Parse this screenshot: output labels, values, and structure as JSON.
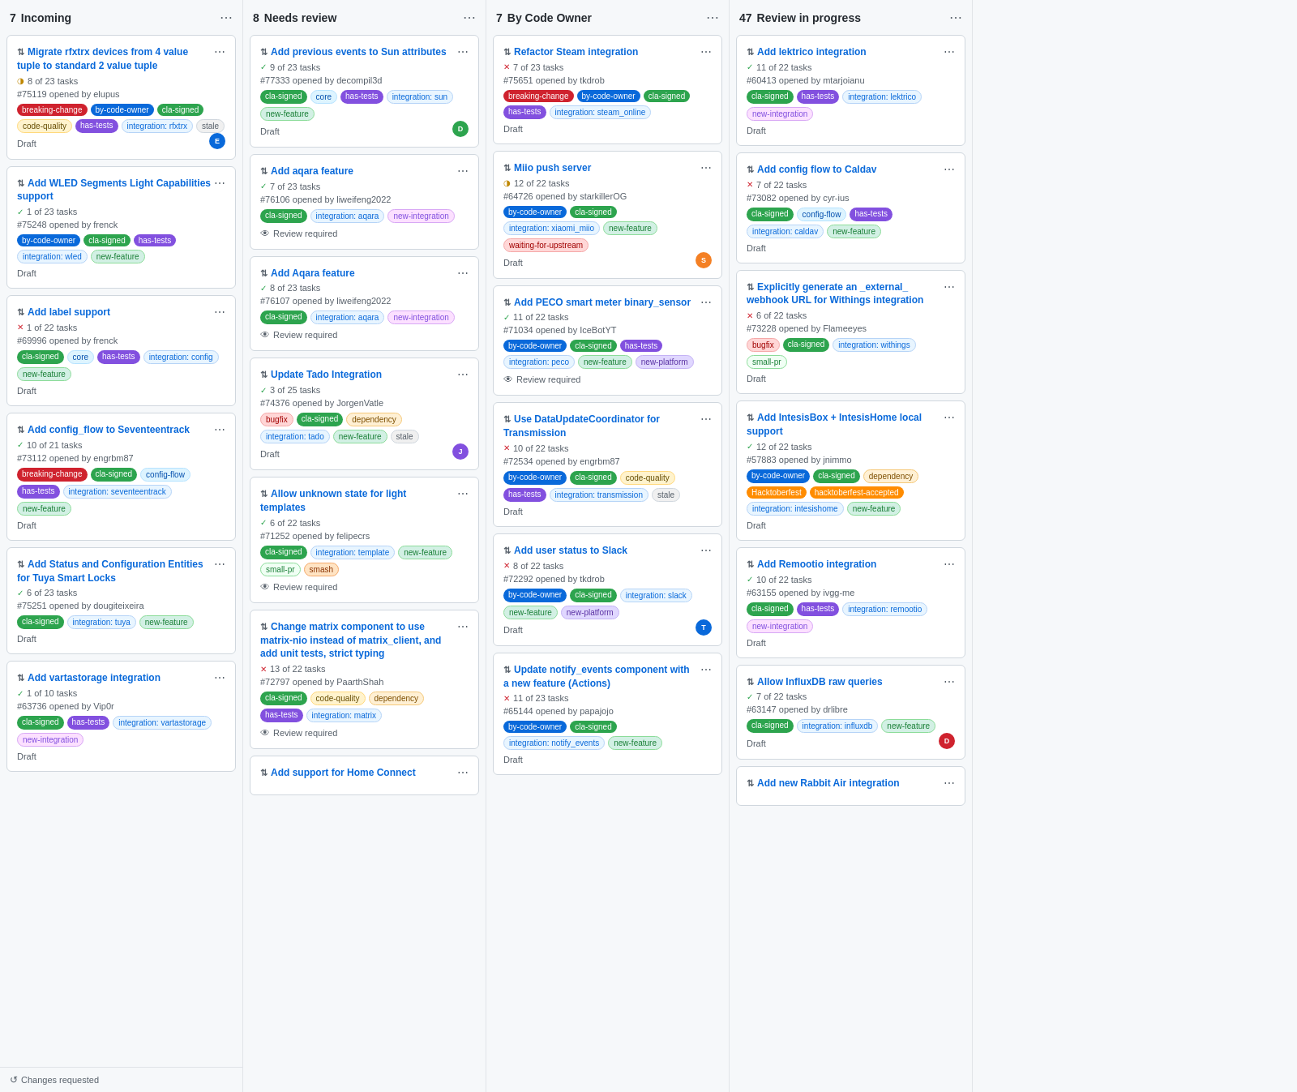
{
  "columns": [
    {
      "id": "incoming",
      "count": "7",
      "title": "Incoming",
      "footer": "Changes requested",
      "cards": [
        {
          "id": "card-1",
          "title": "Migrate rfxtrx devices from 4 value tuple to standard 2 value tuple",
          "tasks": "8 of 23 tasks",
          "task_status": "partial",
          "issue": "#75119 opened by elupus",
          "tags": [
            "breaking-change",
            "by-code-owner",
            "cla-signed",
            "code-quality",
            "has-tests",
            "integration: rfxtrx",
            "stale"
          ],
          "tag_types": {
            "breaking-change": "breaking",
            "by-code-owner": "by-code-owner",
            "cla-signed": "cla-signed",
            "code-quality": "code-quality",
            "has-tests": "has-tests",
            "integration: rfxtrx": "integration",
            "stale": "stale"
          },
          "status": "Draft",
          "avatar": "E",
          "avatar_color": "blue"
        },
        {
          "id": "card-2",
          "title": "Add WLED Segments Light Capabilities support",
          "tasks": "1 of 23 tasks",
          "task_status": "complete",
          "issue": "#75248 opened by frenck",
          "tags": [
            "by-code-owner",
            "cla-signed",
            "has-tests",
            "integration: wled",
            "new-feature"
          ],
          "tag_types": {
            "by-code-owner": "by-code-owner",
            "cla-signed": "cla-signed",
            "has-tests": "has-tests",
            "integration: wled": "integration",
            "new-feature": "new-feature"
          },
          "status": "Draft",
          "avatar": null
        },
        {
          "id": "card-3",
          "title": "Add label support",
          "tasks": "1 of 22 tasks",
          "task_status": "cross",
          "issue": "#69996 opened by frenck",
          "tags": [
            "cla-signed",
            "core",
            "has-tests",
            "integration: config",
            "new-feature"
          ],
          "tag_types": {
            "cla-signed": "cla-signed",
            "core": "core",
            "has-tests": "has-tests",
            "integration: config": "integration",
            "new-feature": "new-feature"
          },
          "status": "Draft",
          "avatar": null
        },
        {
          "id": "card-4",
          "title": "Add config_flow to Seventeentrack",
          "tasks": "10 of 21 tasks",
          "task_status": "complete",
          "issue": "#73112 opened by engrbm87",
          "tags": [
            "breaking-change",
            "cla-signed",
            "config-flow",
            "has-tests",
            "integration: seventeentrack",
            "new-feature"
          ],
          "tag_types": {
            "breaking-change": "breaking",
            "cla-signed": "cla-signed",
            "config-flow": "config-flow",
            "has-tests": "has-tests",
            "integration: seventeentrack": "integration",
            "new-feature": "new-feature"
          },
          "status": "Draft",
          "avatar": null
        },
        {
          "id": "card-5",
          "title": "Add Status and Configuration Entities for Tuya Smart Locks",
          "tasks": "6 of 23 tasks",
          "task_status": "complete",
          "issue": "#75251 opened by dougiteixeira",
          "tags": [
            "cla-signed",
            "integration: tuya",
            "new-feature"
          ],
          "tag_types": {
            "cla-signed": "cla-signed",
            "integration: tuya": "integration",
            "new-feature": "new-feature"
          },
          "status": "Draft",
          "avatar": null
        },
        {
          "id": "card-6",
          "title": "Add vartastorage integration",
          "tasks": "1 of 10 tasks",
          "task_status": "complete",
          "issue": "#63736 opened by Vip0r",
          "tags": [
            "cla-signed",
            "has-tests",
            "integration: vartastorage",
            "new-integration"
          ],
          "tag_types": {
            "cla-signed": "cla-signed",
            "has-tests": "has-tests",
            "integration: vartastorage": "integration",
            "new-integration": "new-integration"
          },
          "status": "Draft",
          "avatar": null
        }
      ]
    },
    {
      "id": "needs-review",
      "count": "8",
      "title": "Needs review",
      "footer": null,
      "cards": [
        {
          "id": "nr-1",
          "title": "Add previous events to Sun attributes",
          "tasks": "9 of 23 tasks",
          "task_status": "complete",
          "issue": "#77333 opened by decompil3d",
          "tags": [
            "cla-signed",
            "core",
            "has-tests",
            "integration: sun",
            "new-feature"
          ],
          "tag_types": {
            "cla-signed": "cla-signed",
            "core": "core",
            "has-tests": "has-tests",
            "integration: sun": "integration",
            "new-feature": "new-feature"
          },
          "status": "Draft",
          "avatar": "D",
          "avatar_color": "green"
        },
        {
          "id": "nr-2",
          "title": "Add aqara feature",
          "tasks": "7 of 23 tasks",
          "task_status": "complete",
          "issue": "#76106 opened by liweifeng2022",
          "tags": [
            "cla-signed",
            "integration: aqara",
            "new-integration"
          ],
          "tag_types": {
            "cla-signed": "cla-signed",
            "integration: aqara": "integration",
            "new-integration": "new-integration"
          },
          "status": "Review required",
          "avatar": null
        },
        {
          "id": "nr-3",
          "title": "Add Aqara feature",
          "tasks": "8 of 23 tasks",
          "task_status": "complete",
          "issue": "#76107 opened by liweifeng2022",
          "tags": [
            "cla-signed",
            "integration: aqara",
            "new-integration"
          ],
          "tag_types": {
            "cla-signed": "cla-signed",
            "integration: aqara": "integration",
            "new-integration": "new-integration"
          },
          "status": "Review required",
          "avatar": null
        },
        {
          "id": "nr-4",
          "title": "Update Tado Integration",
          "tasks": "3 of 25 tasks",
          "task_status": "complete",
          "issue": "#74376 opened by JorgenVatle",
          "tags": [
            "bugfix",
            "cla-signed",
            "dependency",
            "integration: tado",
            "new-feature",
            "stale"
          ],
          "tag_types": {
            "bugfix": "bugfix",
            "cla-signed": "cla-signed",
            "dependency": "dependency",
            "integration: tado": "integration",
            "new-feature": "new-feature",
            "stale": "stale"
          },
          "status": "Draft",
          "avatar": "J",
          "avatar_color": "purple"
        },
        {
          "id": "nr-5",
          "title": "Allow unknown state for light templates",
          "tasks": "6 of 22 tasks",
          "task_status": "complete",
          "issue": "#71252 opened by felipecrs",
          "tags": [
            "cla-signed",
            "integration: template",
            "new-feature",
            "small-pr",
            "smash"
          ],
          "tag_types": {
            "cla-signed": "cla-signed",
            "integration: template": "integration",
            "new-feature": "new-feature",
            "small-pr": "small-pr",
            "smash": "smash"
          },
          "status": "Review required",
          "avatar": null
        },
        {
          "id": "nr-6",
          "title": "Change matrix component to use matrix-nio instead of matrix_client, and add unit tests, strict typing",
          "tasks": "13 of 22 tasks",
          "task_status": "cross",
          "issue": "#72797 opened by PaarthShah",
          "tags": [
            "cla-signed",
            "code-quality",
            "dependency",
            "has-tests",
            "integration: matrix"
          ],
          "tag_types": {
            "cla-signed": "cla-signed",
            "code-quality": "code-quality",
            "dependency": "dependency",
            "has-tests": "has-tests",
            "integration: matrix": "integration"
          },
          "status": "Review required",
          "avatar": null
        },
        {
          "id": "nr-7",
          "title": "Add support for Home Connect",
          "tasks": "",
          "task_status": "partial",
          "issue": "",
          "tags": [],
          "tag_types": {},
          "status": "",
          "avatar": null
        }
      ]
    },
    {
      "id": "by-code-owner",
      "count": "7",
      "title": "By Code Owner",
      "footer": null,
      "cards": [
        {
          "id": "bco-1",
          "title": "Refactor Steam integration",
          "tasks": "7 of 23 tasks",
          "task_status": "cross",
          "issue": "#75651 opened by tkdrob",
          "tags": [
            "breaking-change",
            "by-code-owner",
            "cla-signed",
            "has-tests",
            "integration: steam_online"
          ],
          "tag_types": {
            "breaking-change": "breaking",
            "by-code-owner": "by-code-owner",
            "cla-signed": "cla-signed",
            "has-tests": "has-tests",
            "integration: steam_online": "integration"
          },
          "status": "Draft",
          "avatar": null
        },
        {
          "id": "bco-2",
          "title": "Miio push server",
          "tasks": "12 of 22 tasks",
          "task_status": "partial",
          "issue": "#64726 opened by starkillerOG",
          "tags": [
            "by-code-owner",
            "cla-signed",
            "integration: xiaomi_miio",
            "new-feature",
            "waiting-for-upstream"
          ],
          "tag_types": {
            "by-code-owner": "by-code-owner",
            "cla-signed": "cla-signed",
            "integration: xiaomi_miio": "integration",
            "new-feature": "new-feature",
            "waiting-for-upstream": "waiting-upstream"
          },
          "status": "Draft",
          "avatar": "S",
          "avatar_color": "orange"
        },
        {
          "id": "bco-3",
          "title": "Add PECO smart meter binary_sensor",
          "tasks": "11 of 22 tasks",
          "task_status": "complete",
          "issue": "#71034 opened by IceBotYT",
          "tags": [
            "by-code-owner",
            "cla-signed",
            "has-tests",
            "integration: peco",
            "new-feature",
            "new-platform"
          ],
          "tag_types": {
            "by-code-owner": "by-code-owner",
            "cla-signed": "cla-signed",
            "has-tests": "has-tests",
            "integration: peco": "integration",
            "new-feature": "new-feature",
            "new-platform": "new-platform"
          },
          "status": "Review required",
          "avatar": null
        },
        {
          "id": "bco-4",
          "title": "Use DataUpdateCoordinator for Transmission",
          "tasks": "10 of 22 tasks",
          "task_status": "cross",
          "issue": "#72534 opened by engrbm87",
          "tags": [
            "by-code-owner",
            "cla-signed",
            "code-quality",
            "has-tests",
            "integration: transmission",
            "stale"
          ],
          "tag_types": {
            "by-code-owner": "by-code-owner",
            "cla-signed": "cla-signed",
            "code-quality": "code-quality",
            "has-tests": "has-tests",
            "integration: transmission": "integration",
            "stale": "stale"
          },
          "status": "Draft",
          "avatar": null
        },
        {
          "id": "bco-5",
          "title": "Add user status to Slack",
          "tasks": "8 of 22 tasks",
          "task_status": "cross",
          "issue": "#72292 opened by tkdrob",
          "tags": [
            "by-code-owner",
            "cla-signed",
            "integration: slack",
            "new-feature",
            "new-platform"
          ],
          "tag_types": {
            "by-code-owner": "by-code-owner",
            "cla-signed": "cla-signed",
            "integration: slack": "integration",
            "new-feature": "new-feature",
            "new-platform": "new-platform"
          },
          "status": "Draft",
          "avatar": "T",
          "avatar_color": "blue"
        },
        {
          "id": "bco-6",
          "title": "Update notify_events component with a new feature (Actions)",
          "tasks": "11 of 23 tasks",
          "task_status": "cross",
          "issue": "#65144 opened by papajojo",
          "tags": [
            "by-code-owner",
            "cla-signed",
            "integration: notify_events",
            "new-feature"
          ],
          "tag_types": {
            "by-code-owner": "by-code-owner",
            "cla-signed": "cla-signed",
            "integration: notify_events": "integration",
            "new-feature": "new-feature"
          },
          "status": "Draft",
          "avatar": null
        }
      ]
    },
    {
      "id": "review-in-progress",
      "count": "47",
      "title": "Review in progress",
      "footer": null,
      "cards": [
        {
          "id": "rip-1",
          "title": "Add lektrico integration",
          "tasks": "11 of 22 tasks",
          "task_status": "complete",
          "issue": "#60413 opened by mtarjoianu",
          "tags": [
            "cla-signed",
            "has-tests",
            "integration: lektrico",
            "new-integration"
          ],
          "tag_types": {
            "cla-signed": "cla-signed",
            "has-tests": "has-tests",
            "integration: lektrico": "integration",
            "new-integration": "new-integration"
          },
          "status": "Draft",
          "avatar": null
        },
        {
          "id": "rip-2",
          "title": "Add config flow to Caldav",
          "tasks": "7 of 22 tasks",
          "task_status": "cross",
          "issue": "#73082 opened by cyr-ius",
          "tags": [
            "cla-signed",
            "config-flow",
            "has-tests",
            "integration: caldav",
            "new-feature"
          ],
          "tag_types": {
            "cla-signed": "cla-signed",
            "config-flow": "config-flow",
            "has-tests": "has-tests",
            "integration: caldav": "integration",
            "new-feature": "new-feature"
          },
          "status": "Draft",
          "avatar": null
        },
        {
          "id": "rip-3",
          "title": "Explicitly generate an _external_ webhook URL for Withings integration",
          "tasks": "6 of 22 tasks",
          "task_status": "cross",
          "issue": "#73228 opened by Flameeyes",
          "tags": [
            "bugfix",
            "cla-signed",
            "integration: withings",
            "small-pr"
          ],
          "tag_types": {
            "bugfix": "bugfix",
            "cla-signed": "cla-signed",
            "integration: withings": "integration",
            "small-pr": "small-pr"
          },
          "status": "Draft",
          "avatar": null
        },
        {
          "id": "rip-4",
          "title": "Add IntesisBox + IntesisHome local support",
          "tasks": "12 of 22 tasks",
          "task_status": "complete",
          "issue": "#57883 opened by jnimmo",
          "tags": [
            "by-code-owner",
            "cla-signed",
            "dependency",
            "Hacktoberfest",
            "hacktoberfest-accepted",
            "integration: intesishome",
            "new-feature"
          ],
          "tag_types": {
            "by-code-owner": "by-code-owner",
            "cla-signed": "cla-signed",
            "dependency": "dependency",
            "Hacktoberfest": "hacktoberfest",
            "hacktoberfest-accepted": "hacktoberfest-accepted",
            "integration: intesishome": "integration",
            "new-feature": "new-feature"
          },
          "status": "Draft",
          "avatar": null
        },
        {
          "id": "rip-5",
          "title": "Add Remootio integration",
          "tasks": "10 of 22 tasks",
          "task_status": "complete",
          "issue": "#63155 opened by ivgg-me",
          "tags": [
            "cla-signed",
            "has-tests",
            "integration: remootio",
            "new-integration"
          ],
          "tag_types": {
            "cla-signed": "cla-signed",
            "has-tests": "has-tests",
            "integration: remootio": "integration",
            "new-integration": "new-integration"
          },
          "status": "Draft",
          "avatar": null
        },
        {
          "id": "rip-6",
          "title": "Allow InfluxDB raw queries",
          "tasks": "7 of 22 tasks",
          "task_status": "complete",
          "issue": "#63147 opened by drlibre",
          "tags": [
            "cla-signed",
            "integration: influxdb",
            "new-feature"
          ],
          "tag_types": {
            "cla-signed": "cla-signed",
            "integration: influxdb": "integration",
            "new-feature": "new-feature"
          },
          "status": "Draft",
          "avatar": "D",
          "avatar_color": "red"
        },
        {
          "id": "rip-7",
          "title": "Add new Rabbit Air integration",
          "tasks": "",
          "task_status": "partial",
          "issue": "",
          "tags": [],
          "tag_types": {},
          "status": "",
          "avatar": null
        }
      ]
    }
  ],
  "labels": {
    "menu": "⋯",
    "draft": "Draft",
    "review_required": "Review required",
    "changes_requested": "Changes requested"
  }
}
